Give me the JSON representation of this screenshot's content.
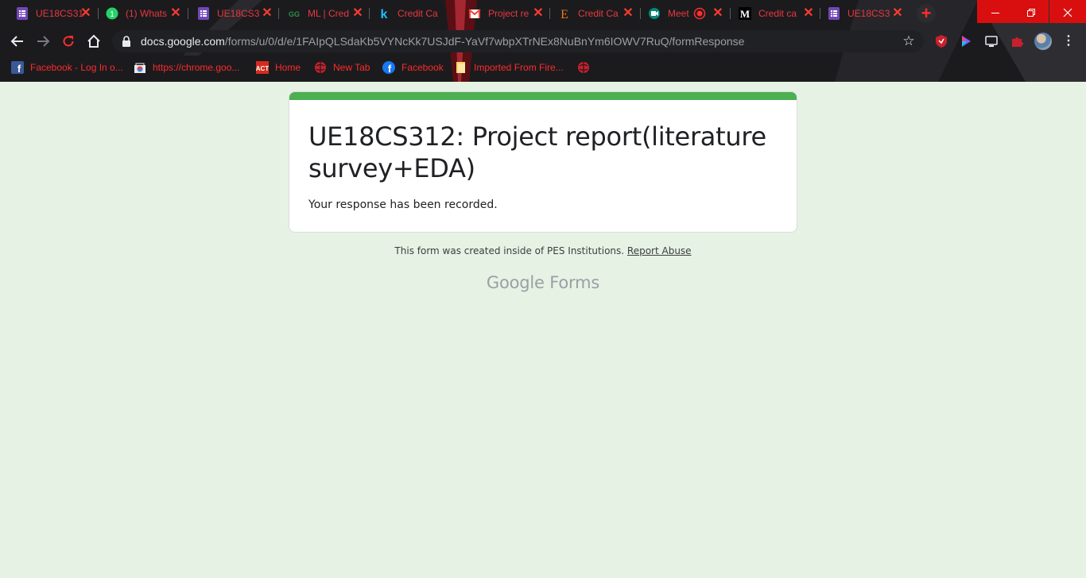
{
  "browser": {
    "tabs": [
      {
        "title": "UE18CS31",
        "favicon": "google-forms-icon"
      },
      {
        "title": "(1) Whats",
        "favicon": "whatsapp-icon"
      },
      {
        "title": "UE18CS3",
        "favicon": "google-forms-icon"
      },
      {
        "title": "ML | Cred",
        "favicon": "geeksforgeeks-icon"
      },
      {
        "title": "Credit Ca",
        "favicon": "kaggle-icon"
      },
      {
        "title": "Project re",
        "favicon": "gmail-icon"
      },
      {
        "title": "Credit Ca",
        "favicon": "e-letter-icon"
      },
      {
        "title": "Meet",
        "favicon": "google-meet-icon",
        "recording": true
      },
      {
        "title": "Credit ca",
        "favicon": "medium-icon"
      },
      {
        "title": "UE18CS3",
        "favicon": "google-forms-icon",
        "active": true
      }
    ],
    "url_host": "docs.google.com",
    "url_path": "/forms/u/0/d/e/1FAIpQLSdaKb5VYNcKk7USJdF-YaVf7wbpXTrNEx8NuBnYm6IOWV7RuQ/formResponse",
    "bookmarks": [
      {
        "label": "Facebook - Log In o...",
        "icon": "facebook-icon"
      },
      {
        "label": "https://chrome.goo...",
        "icon": "chrome-store-icon"
      },
      {
        "label": "Home",
        "icon": "act-icon"
      },
      {
        "label": "New Tab",
        "icon": "globe-icon"
      },
      {
        "label": "Facebook",
        "icon": "facebook-icon"
      },
      {
        "label": "Imported From Fire...",
        "icon": "folder-icon"
      },
      {
        "label": "",
        "icon": "globe-icon"
      }
    ],
    "colors": {
      "tab_text": "#e8383d",
      "window_controls": "#d90f0f"
    }
  },
  "form": {
    "title": "UE18CS312: Project report(literature survey+EDA)",
    "confirmation": "Your response has been recorded.",
    "accent_color": "#4caf50",
    "background_color": "#e6f2e3"
  },
  "footer": {
    "note": "This form was created inside of PES Institutions.",
    "report_link": "Report Abuse",
    "brand_google": "Google",
    "brand_forms": "Forms"
  }
}
